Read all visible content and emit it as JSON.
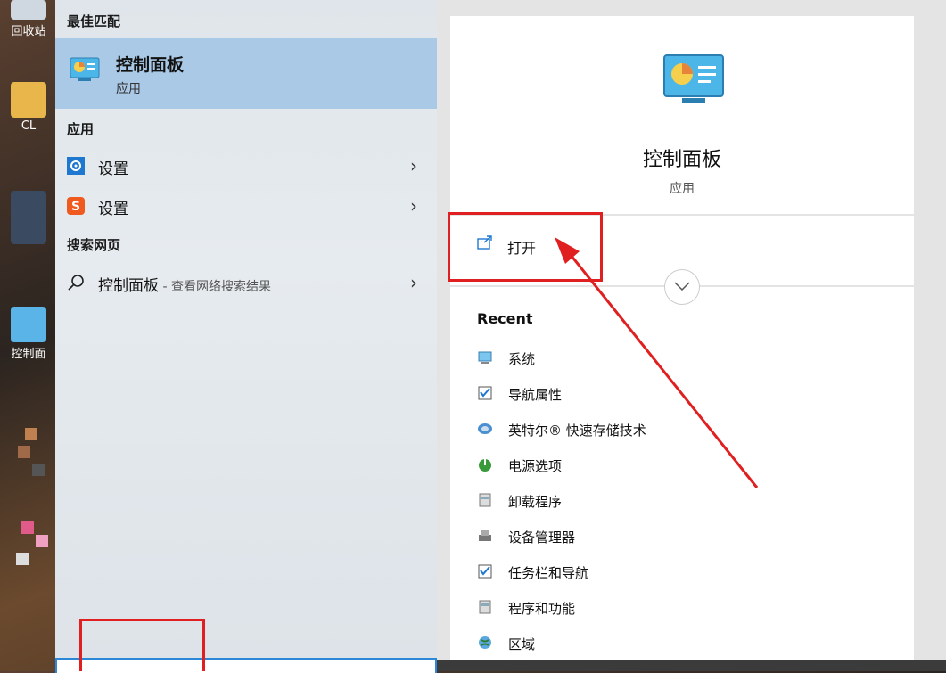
{
  "desktop": {
    "icons": [
      {
        "label": "回收站"
      },
      {
        "label": "CL"
      },
      {
        "label": "控制面"
      }
    ]
  },
  "left": {
    "best_match_header": "最佳匹配",
    "best_match": {
      "title": "控制面板",
      "subtitle": "应用",
      "icon": "control-panel-icon"
    },
    "apps_header": "应用",
    "apps": [
      {
        "label": "设置",
        "icon": "gear-icon"
      },
      {
        "label": "设置",
        "icon": "sogou-icon"
      }
    ],
    "web_header": "搜索网页",
    "web": {
      "label": "控制面板",
      "hint": " - 查看网络搜索结果",
      "icon": "search-icon"
    }
  },
  "right": {
    "app_name": "控制面板",
    "app_type": "应用",
    "open_label": "打开",
    "recent_header": "Recent",
    "recent": [
      {
        "label": "系统",
        "icon": "system-icon"
      },
      {
        "label": "导航属性",
        "icon": "navigation-icon"
      },
      {
        "label": "英特尔® 快速存储技术",
        "icon": "intel-storage-icon"
      },
      {
        "label": "电源选项",
        "icon": "power-icon"
      },
      {
        "label": "卸载程序",
        "icon": "uninstall-icon"
      },
      {
        "label": "设备管理器",
        "icon": "device-manager-icon"
      },
      {
        "label": "任务栏和导航",
        "icon": "taskbar-icon"
      },
      {
        "label": "程序和功能",
        "icon": "programs-icon"
      },
      {
        "label": "区域",
        "icon": "region-icon"
      }
    ]
  },
  "colors": {
    "highlight": "#a9c9e6",
    "annotation": "#e02020",
    "accent": "#2b88d8"
  }
}
